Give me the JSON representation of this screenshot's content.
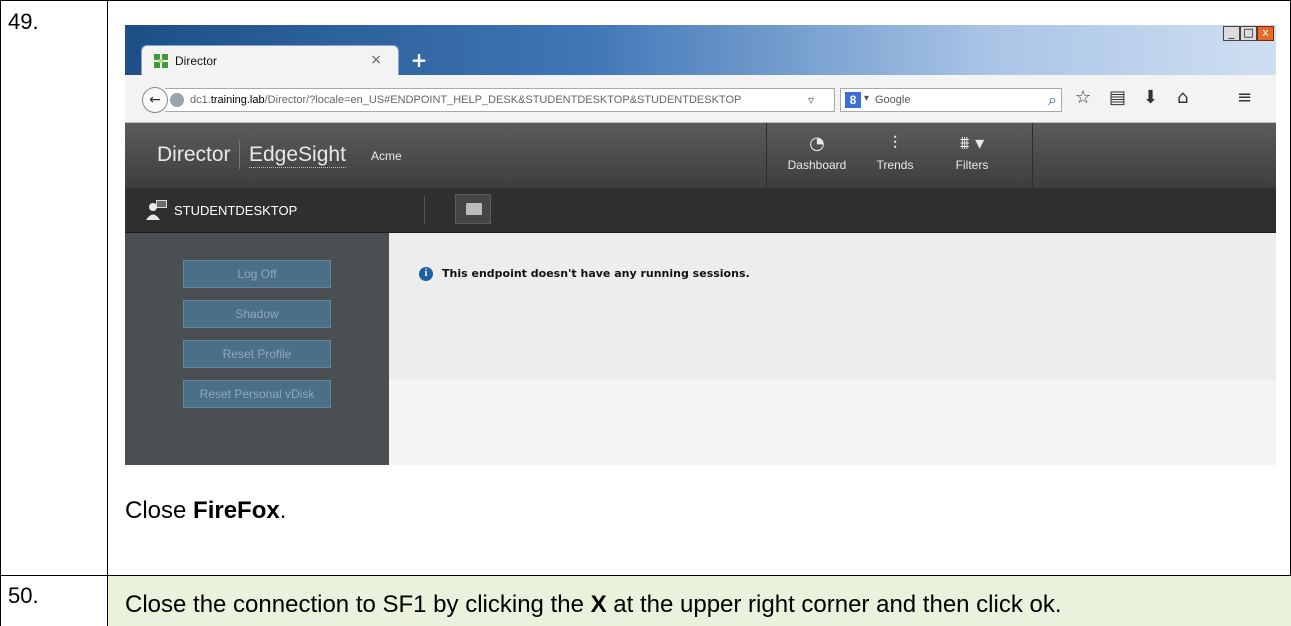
{
  "steps": [
    {
      "number": "49.",
      "instruction": {
        "prefix": "Close ",
        "bold": "FireFox",
        "suffix": "."
      }
    },
    {
      "number": "50.",
      "instruction": {
        "prefix": "Close the connection to SF1 by clicking the ",
        "bold": "X",
        "suffix": " at the upper right corner and then click ok."
      }
    }
  ],
  "browser": {
    "window_buttons": {
      "minimize": "_",
      "maximize": "□",
      "close": "x"
    },
    "tab": {
      "title": "Director",
      "close_glyph": "×",
      "icon": "director-icon"
    },
    "new_tab_glyph": "+",
    "url": {
      "prefix": "dc1.",
      "host": "training.lab",
      "path": "/Director/?locale=en_US#ENDPOINT_HELP_DESK&STUDENTDESKTOP&STUDENTDESKTOP"
    },
    "search": {
      "engine_glyph": "8",
      "placeholder": "Google"
    },
    "nav_icons": [
      "back-icon",
      "reload-icon",
      "search-icon",
      "bookmark-star-icon",
      "bookmarks-list-icon",
      "download-icon",
      "home-icon",
      "menu-icon"
    ]
  },
  "director": {
    "brand": "Director",
    "product": "EdgeSight",
    "site": "Acme",
    "nav": [
      {
        "label": "Dashboard",
        "icon": "dashboard-icon"
      },
      {
        "label": "Trends",
        "icon": "trends-icon"
      },
      {
        "label": "Filters",
        "icon": "filters-icon"
      }
    ],
    "machine": "STUDENTDESKTOP",
    "actions": [
      "Log Off",
      "Shadow",
      "Reset Profile",
      "Reset Personal vDisk"
    ],
    "message": "This endpoint doesn't have any running sessions."
  },
  "colors": {
    "row50_background": "#eaf1dd",
    "header_dark": "#3e3e3e",
    "action_button": "#4b6f86",
    "info_blue": "#1f5fa3"
  }
}
